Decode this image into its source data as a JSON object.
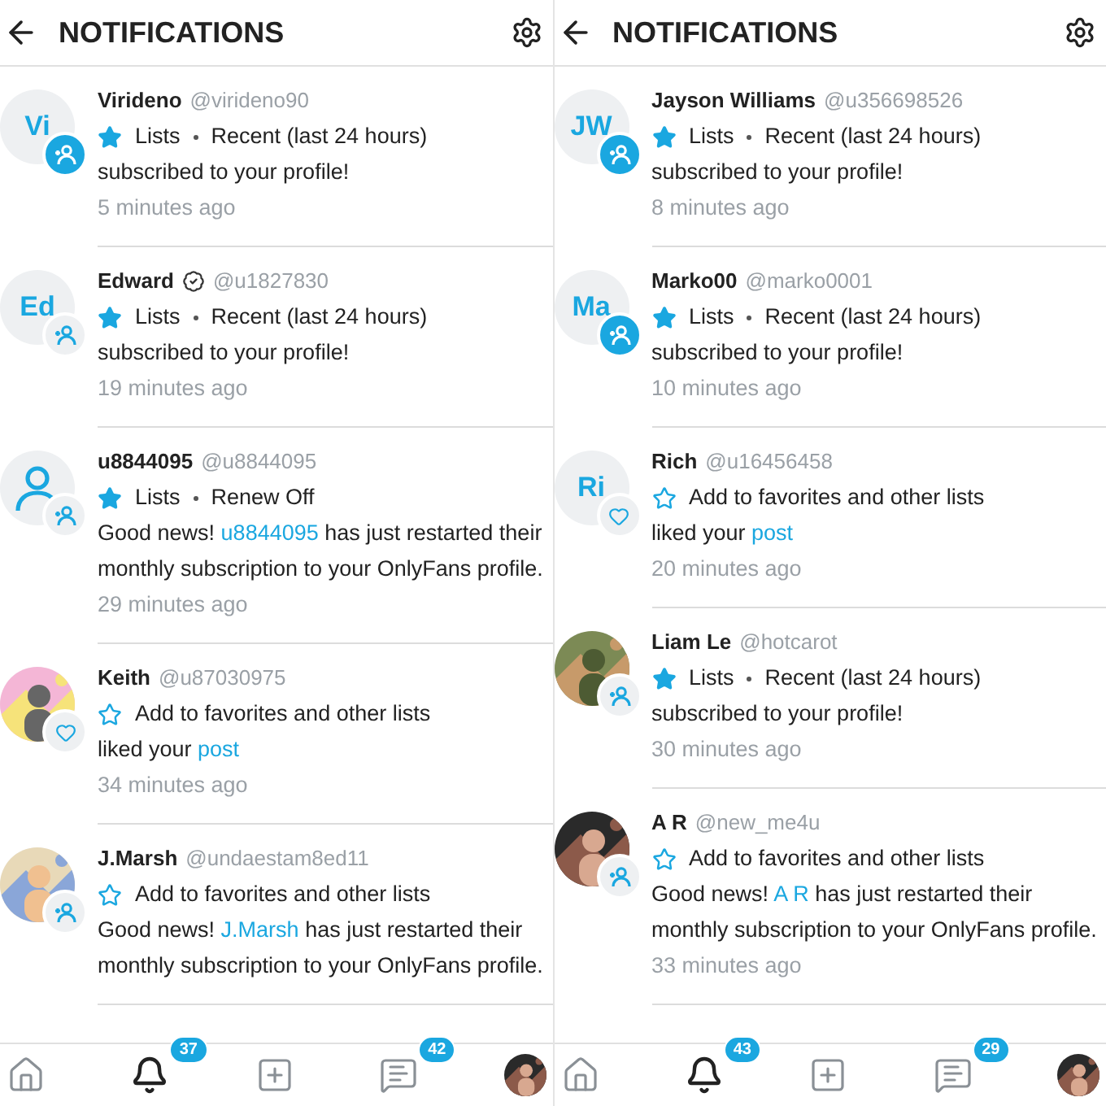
{
  "panels": [
    {
      "title": "NOTIFICATIONS",
      "notifications": [
        {
          "name": "Virideno",
          "handle": "@virideno90",
          "avatar": {
            "kind": "initials",
            "initials": "Vi"
          },
          "badge": {
            "kind": "subscribe",
            "highlighted": true
          },
          "tag": {
            "kind": "lists",
            "label": "Lists",
            "detail": "Recent (last 24 hours)"
          },
          "message": {
            "before": "subscribed to your profile!"
          },
          "time": "5 minutes ago"
        },
        {
          "name": "Edward",
          "handle": "@u1827830",
          "verified": true,
          "avatar": {
            "kind": "initials",
            "initials": "Ed"
          },
          "badge": {
            "kind": "subscribe",
            "highlighted": false
          },
          "tag": {
            "kind": "lists",
            "label": "Lists",
            "detail": "Recent (last 24 hours)"
          },
          "message": {
            "before": "subscribed to your profile!"
          },
          "time": "19 minutes ago"
        },
        {
          "name": "u8844095",
          "handle": "@u8844095",
          "avatar": {
            "kind": "placeholder"
          },
          "badge": {
            "kind": "subscribe",
            "highlighted": false
          },
          "tag": {
            "kind": "lists",
            "label": "Lists",
            "detail": "Renew Off"
          },
          "message": {
            "before": "Good news! ",
            "link": "u8844095",
            "after": " has just restarted their monthly subscription to your OnlyFans profile."
          },
          "time": "29 minutes ago"
        },
        {
          "name": "Keith",
          "handle": "@u87030975",
          "badge": {
            "kind": "like",
            "highlighted": false
          },
          "tag": {
            "kind": "favorites",
            "label": "Add to favorites and other lists"
          },
          "message": {
            "before": "liked your ",
            "link": "post"
          },
          "time": "34 minutes ago"
        },
        {
          "name": "J.Marsh",
          "handle": "@undaestam8ed11",
          "badge": {
            "kind": "subscribe",
            "highlighted": false
          },
          "tag": {
            "kind": "favorites",
            "label": "Add to favorites and other lists"
          },
          "message": {
            "before": "Good news! ",
            "link": "J.Marsh",
            "after": " has just restarted their monthly subscription to your OnlyFans profile."
          }
        }
      ],
      "nav": [
        {
          "kind": "home",
          "selected": false
        },
        {
          "kind": "notifications",
          "selected": true,
          "count": "37"
        },
        {
          "kind": "add",
          "selected": false
        },
        {
          "kind": "messages",
          "selected": false,
          "count": "42"
        },
        {
          "kind": "profile",
          "selected": false
        }
      ]
    },
    {
      "title": "NOTIFICATIONS",
      "notifications": [
        {
          "name": "Jayson Williams",
          "handle": "@u356698526",
          "avatar": {
            "kind": "initials",
            "initials": "JW"
          },
          "badge": {
            "kind": "subscribe",
            "highlighted": true
          },
          "tag": {
            "kind": "lists",
            "label": "Lists",
            "detail": "Recent (last 24 hours)"
          },
          "message": {
            "before": "subscribed to your profile!"
          },
          "time": "8 minutes ago"
        },
        {
          "name": "Marko00",
          "handle": "@marko0001",
          "avatar": {
            "kind": "initials",
            "initials": "Ma"
          },
          "badge": {
            "kind": "subscribe",
            "highlighted": true
          },
          "tag": {
            "kind": "lists",
            "label": "Lists",
            "detail": "Recent (last 24 hours)"
          },
          "message": {
            "before": "subscribed to your profile!"
          },
          "time": "10 minutes ago"
        },
        {
          "name": "Rich",
          "handle": "@u16456458",
          "avatar": {
            "kind": "initials",
            "initials": "Ri"
          },
          "badge": {
            "kind": "like",
            "highlighted": false
          },
          "tag": {
            "kind": "favorites",
            "label": "Add to favorites and other lists"
          },
          "message": {
            "before": "liked your ",
            "link": "post"
          },
          "time": "20 minutes ago"
        },
        {
          "name": "Liam Le",
          "handle": "@hotcarot",
          "badge": {
            "kind": "subscribe",
            "highlighted": false
          },
          "tag": {
            "kind": "lists",
            "label": "Lists",
            "detail": "Recent (last 24 hours)"
          },
          "message": {
            "before": "subscribed to your profile!"
          },
          "time": "30 minutes ago"
        },
        {
          "name": "A R",
          "handle": "@new_me4u",
          "badge": {
            "kind": "subscribe",
            "highlighted": false
          },
          "tag": {
            "kind": "favorites",
            "label": "Add to favorites and other lists"
          },
          "message": {
            "before": "Good news! ",
            "link": "A R",
            "after": " has just restarted their monthly subscription to your OnlyFans profile."
          },
          "time": "33 minutes ago"
        }
      ],
      "nav": [
        {
          "kind": "home",
          "selected": false
        },
        {
          "kind": "notifications",
          "selected": true,
          "count": "43"
        },
        {
          "kind": "add",
          "selected": false
        },
        {
          "kind": "messages",
          "selected": false,
          "count": "29"
        },
        {
          "kind": "profile",
          "selected": false
        }
      ]
    }
  ]
}
